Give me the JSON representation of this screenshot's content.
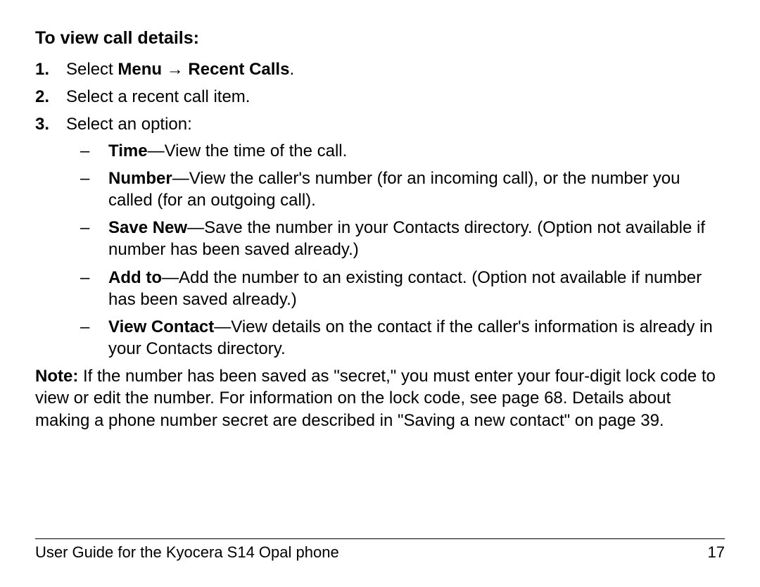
{
  "heading": "To view call details:",
  "steps": [
    {
      "num": "1.",
      "prefix": "Select ",
      "bold1": "Menu",
      "mid": " → ",
      "bold2": "Recent Calls",
      "suffix": "."
    },
    {
      "num": "2.",
      "text": "Select a recent call item."
    },
    {
      "num": "3.",
      "text": "Select an option:"
    }
  ],
  "options": [
    {
      "label": "Time",
      "desc": "—View the time of the call."
    },
    {
      "label": "Number",
      "desc": "—View the caller's number (for an incoming call), or the number you called (for an outgoing call)."
    },
    {
      "label": "Save New",
      "desc": "—Save the number in your Contacts directory. (Option not available if number has been saved already.)"
    },
    {
      "label": "Add to",
      "desc": "—Add the number to an existing contact. (Option not available if number has been saved already.)"
    },
    {
      "label": "View Contact",
      "desc": "—View details on the contact if the caller's information is already in your Contacts directory."
    }
  ],
  "note": {
    "label": "Note:",
    "body": " If the number has been saved as \"secret,\" you must enter your four-digit lock code to view or edit the number. For information on the lock code, see page 68. Details about making a phone number secret are described in \"Saving a new contact\" on page 39."
  },
  "footer": {
    "left": "User Guide for the Kyocera S14 Opal phone",
    "right": "17"
  }
}
